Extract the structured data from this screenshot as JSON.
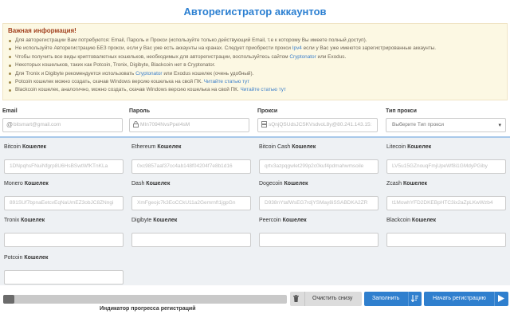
{
  "header": {
    "title": "Авторегистратор аккаунтов"
  },
  "info": {
    "title": "Важная информация!",
    "items": [
      {
        "pre": "Для авторегистрации Вам потребуются: Email, Пароль и Прокси (используйте только действующий Email, т.е к которому Вы имеете полный доступ).",
        "link": "",
        "post": ""
      },
      {
        "pre": "Не используйте Авторегистрацию БЕЗ прокси, если у Вас уже есть аккаунты на кранах. Следует приобрести прокси ",
        "link": "Ipv4",
        "post": " если у Вас уже имеются зарегистрированные аккаунты."
      },
      {
        "pre": "Чтобы получить все виды криптовалютных кошельков, необходимых для авторегистрации, воспользуйтесь сайтом ",
        "link": "Cryptonator",
        "post": " или Exodus."
      },
      {
        "pre": "Некоторых кошельков, таких как Potcoin, Tronix, Digibyte, Blackcoin нет в Cryptonator.",
        "link": "",
        "post": ""
      },
      {
        "pre": "Для Tronix и Digibyte рекомендуется использовать ",
        "link": "Cryptonator",
        "post": " или Exodus кошелек (очень удобный)."
      },
      {
        "pre": "Potcoin кошелек можно создать, скачав Windows версию кошелька на свой ПК. ",
        "link": "Читайте статью тут",
        "post": ""
      },
      {
        "pre": "Blackcoin кошелек, аналогично, можно создать, скачав Windows версию кошелька на свой ПК. ",
        "link": "Читайте статью тут",
        "post": ""
      }
    ]
  },
  "form": {
    "email": {
      "label": "Email",
      "placeholder": "bitsmart@gmail.com",
      "icon": "at-icon"
    },
    "password": {
      "label": "Пароль",
      "placeholder": "MIn7094NvsPpeI4sM",
      "icon": "lock-icon"
    },
    "proxy": {
      "label": "Прокси",
      "placeholder": "sQnjQSUdsJCSKVsdvoL8y@80.241.143.15:",
      "icon": "server-icon"
    },
    "proxy_type": {
      "label": "Тип прокси",
      "value": "Выберите Тип прокси"
    }
  },
  "wallet_suffix": "Кошелек",
  "wallets": [
    {
      "coin": "Bitcoin",
      "placeholder": "1DNpqhsFNuiNfgrp8U6HsBSwtWfKTnKLa"
    },
    {
      "coin": "Ethereum",
      "placeholder": "0xc9857aaf37cc4ab148f04204f7e8b1d16"
    },
    {
      "coin": "Bitcoin Cash",
      "placeholder": "qrtv3azpqgwlet299p2c0kuf4pdmahwmsoile"
    },
    {
      "coin": "Litecoin",
      "placeholder": "LV5u15GZnouqFmjUpeWf8i1GMdyPGiby"
    },
    {
      "coin": "Monero",
      "placeholder": "891SUf7bpnaEetcvEqNaUmEZ3obJC8ZNngi"
    },
    {
      "coin": "Dash",
      "placeholder": "XmFgeojc7k3EoCCkU11a2Gemrnft1jgpGn"
    },
    {
      "coin": "Dogecoin",
      "placeholder": "D938nYtafWsEG7rdjYSMay8iSSABDKA2ZR"
    },
    {
      "coin": "Zcash",
      "placeholder": "t1MowhYFD2DKEBpHTC3ix2aZpLKwWzb4"
    },
    {
      "coin": "Tronix",
      "placeholder": ""
    },
    {
      "coin": "Digibyte",
      "placeholder": ""
    },
    {
      "coin": "Peercoin",
      "placeholder": ""
    },
    {
      "coin": "Blackcoin",
      "placeholder": ""
    },
    {
      "coin": "Potcoin",
      "placeholder": ""
    }
  ],
  "progress": {
    "label": "Индикатор прогресса регистраций",
    "fraction": 0.04
  },
  "buttons": {
    "clear": {
      "label": "Очистить снизу",
      "icon": "trash-icon"
    },
    "fill": {
      "label": "Заполнить",
      "icon": "sort-icon"
    },
    "start": {
      "label": "Начать регистрацию",
      "icon": "play-icon"
    }
  },
  "colors": {
    "accent": "#2f7fce",
    "title": "#2b7fd1",
    "info_bg": "#fcf8e3",
    "info_title": "#a2411f"
  }
}
